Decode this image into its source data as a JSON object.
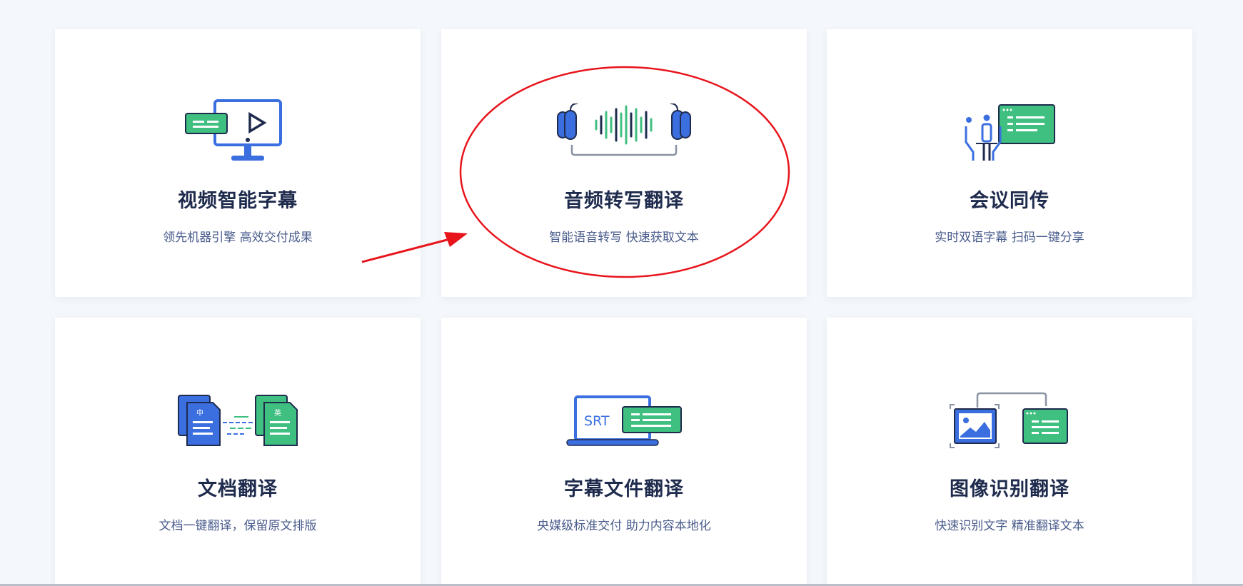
{
  "cards": [
    {
      "title": "视频智能字幕",
      "desc": "领先机器引擎 高效交付成果"
    },
    {
      "title": "音频转写翻译",
      "desc": "智能语音转写 快速获取文本"
    },
    {
      "title": "会议同传",
      "desc": "实时双语字幕 扫码一键分享"
    },
    {
      "title": "文档翻译",
      "desc": "文档一键翻译，保留原文排版"
    },
    {
      "title": "字幕文件翻译",
      "desc": "央媒级标准交付 助力内容本地化"
    },
    {
      "title": "图像识别翻译",
      "desc": "快速识别文字 精准翻译文本"
    }
  ],
  "icons": {
    "doc_left": "中",
    "doc_right": "英",
    "srt": "SRT"
  },
  "colors": {
    "blue": "#3b6fe0",
    "green": "#3fbf80",
    "navy": "#1f2b4d",
    "annotation": "#e8141c"
  }
}
